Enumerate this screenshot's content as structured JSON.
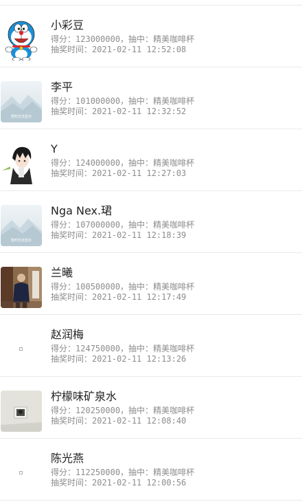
{
  "labels": {
    "score_prefix": "得分：",
    "prize_sep": "，抽中：",
    "time_prefix": "抽奖时间："
  },
  "placeholder_text": "暂时无法显示",
  "colors": {
    "name_text": "#222222",
    "meta_text": "#8c8c8c",
    "divider": "#e9e9e9"
  },
  "records": [
    {
      "name": "小彩豆",
      "score": "123000000",
      "prize": "精美咖啡杯",
      "time": "2021-02-11 12:52:08",
      "avatar": "doraemon"
    },
    {
      "name": "李平",
      "score": "101000000",
      "prize": "精美咖啡杯",
      "time": "2021-02-11 12:32:52",
      "avatar": "placeholder"
    },
    {
      "name": "Y",
      "score": "124000000",
      "prize": "精美咖啡杯",
      "time": "2021-02-11 12:27:03",
      "avatar": "anime-boy"
    },
    {
      "name": "Nga Nex.珺",
      "score": "107000000",
      "prize": "精美咖啡杯",
      "time": "2021-02-11 12:18:39",
      "avatar": "placeholder"
    },
    {
      "name": "兰曦",
      "score": "100500000",
      "prize": "精美咖啡杯",
      "time": "2021-02-11 12:17:49",
      "avatar": "photo-person"
    },
    {
      "name": "赵润梅",
      "score": "124750000",
      "prize": "精美咖啡杯",
      "time": "2021-02-11 12:13:26",
      "avatar": "broken"
    },
    {
      "name": "柠檬味矿泉水",
      "score": "120250000",
      "prize": "精美咖啡杯",
      "time": "2021-02-11 12:08:40",
      "avatar": "photo-frame"
    },
    {
      "name": "陈光燕",
      "score": "112250000",
      "prize": "精美咖啡杯",
      "time": "2021-02-11 12:00:56",
      "avatar": "broken"
    }
  ]
}
